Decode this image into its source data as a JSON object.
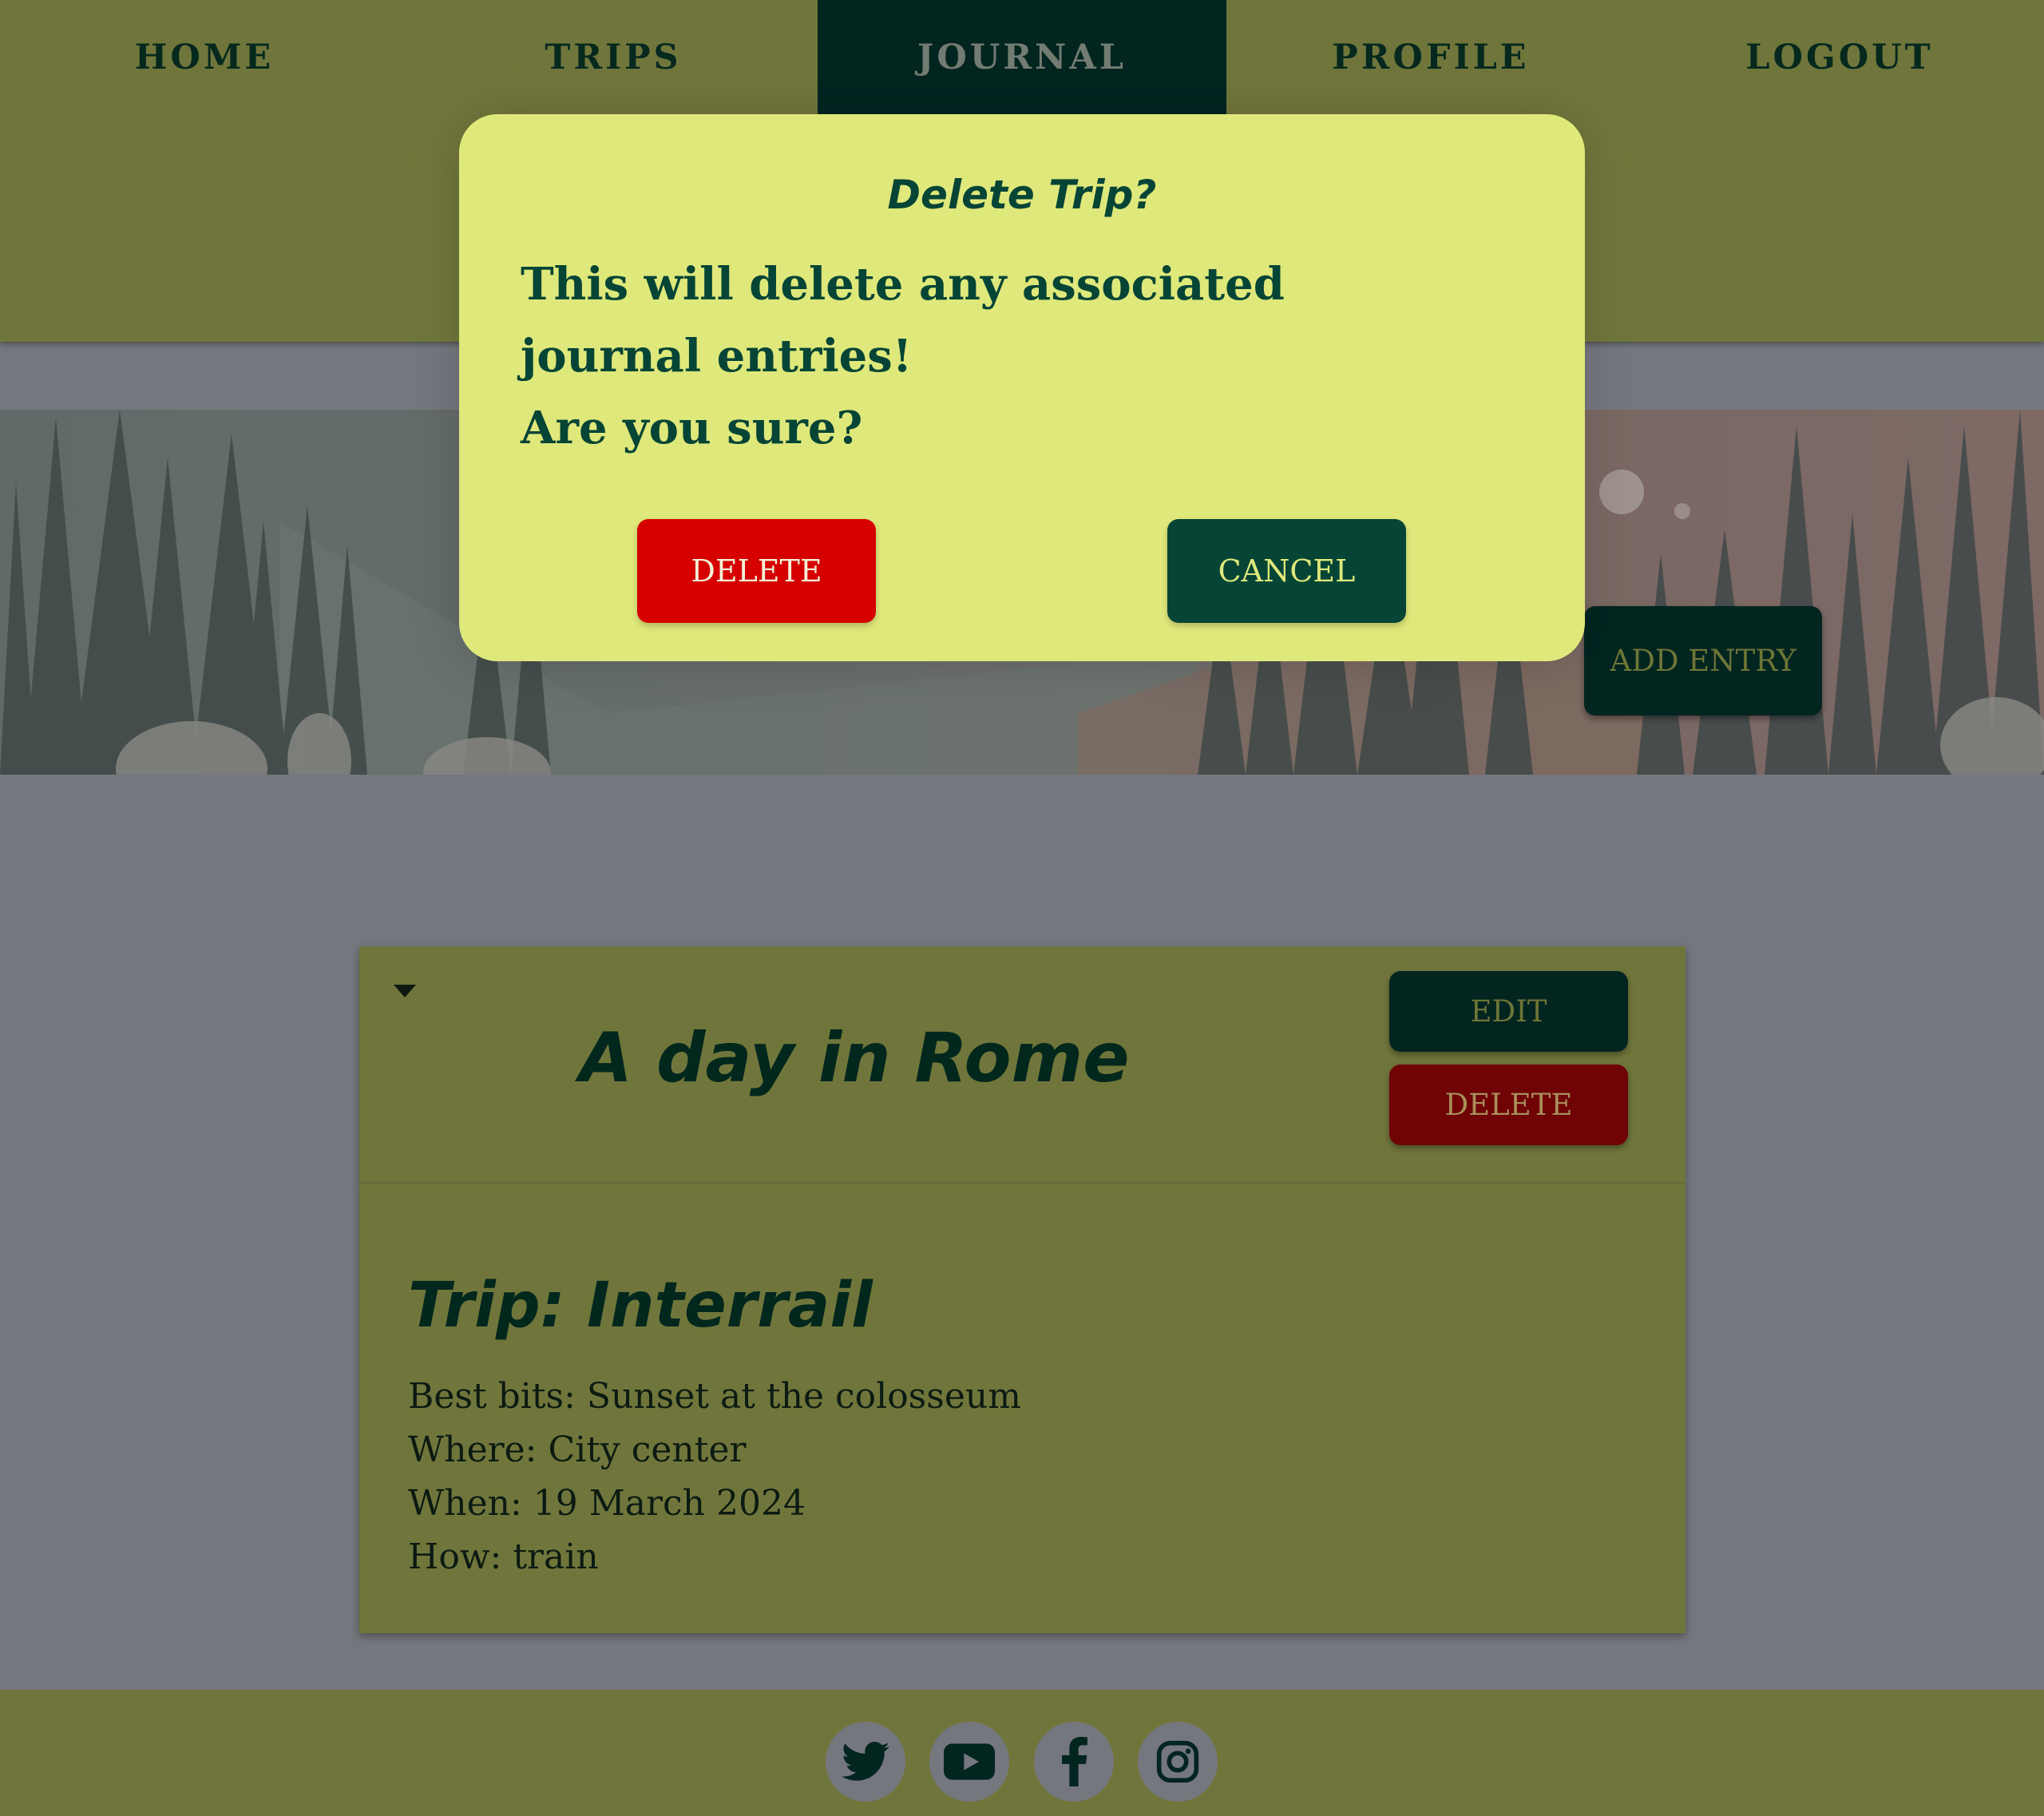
{
  "nav": {
    "items": [
      {
        "label": "HOME"
      },
      {
        "label": "TRIPS"
      },
      {
        "label": "JOURNAL",
        "active": true
      },
      {
        "label": "PROFILE"
      },
      {
        "label": "LOGOUT"
      }
    ]
  },
  "hero": {
    "add_entry_label": "ADD ENTRY"
  },
  "entry": {
    "title": "A day in Rome",
    "edit_label": "EDIT",
    "delete_label": "DELETE",
    "trip_heading": "Trip: Interrail",
    "details": [
      "Best bits: Sunset at the colosseum",
      "Where: City center",
      "When: 19 March 2024",
      "How: train"
    ]
  },
  "footer": {
    "social_icons": [
      "twitter-icon",
      "youtube-icon",
      "facebook-icon",
      "instagram-icon"
    ]
  },
  "modal": {
    "title": "Delete Trip?",
    "message_line1": "This will delete any associated journal entries!",
    "message_line2": "Are you sure?",
    "delete_label": "DELETE",
    "cancel_label": "CANCEL"
  },
  "colors": {
    "nav_bg": "#70763b",
    "nav_active_bg": "#022520",
    "modal_bg": "#dfe87a",
    "modal_text": "#064536",
    "danger": "#d60000",
    "overlay": "#75777e"
  }
}
